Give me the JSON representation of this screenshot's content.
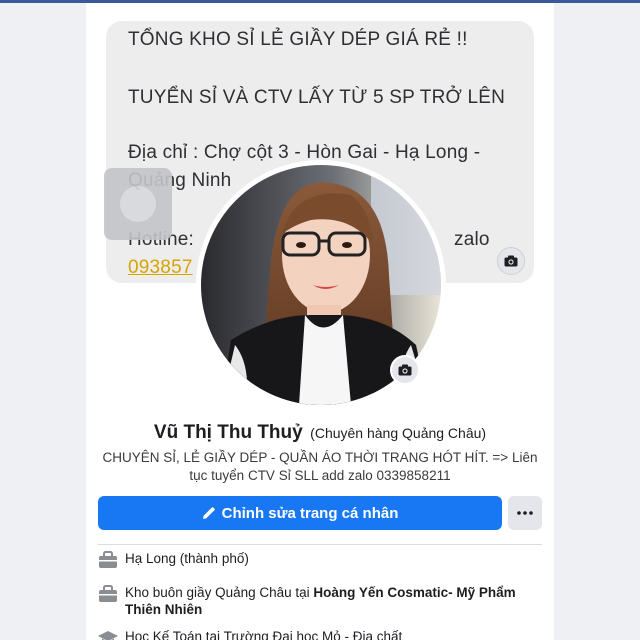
{
  "cover": {
    "lines": [
      "TỔNG KHO SỈ LẺ GIẦY DÉP GIÁ RẺ !!",
      "TUYỂN SỈ VÀ CTV LẤY TỪ 5 SP TRỞ LÊN",
      "Địa chỉ : Chợ cột 3 - Hòn Gai - Hạ Long -",
      "Quảng Ninh",
      "Hotline:",
      "zalo"
    ],
    "phone_partial": "093857",
    "camera_icon": "camera-icon"
  },
  "profile": {
    "name": "Vũ Thị Thu Thuỷ",
    "alternate_name": "(Chuyên hàng Quảng Châu)",
    "bio": "CHUYÊN SỈ, LẺ GIẦY DÉP - QUẦN ÁO THỜI TRANG HÓT HÍT. => Liên tục tuyển CTV Sỉ SLL add zalo 0339858211",
    "edit_button_label": "Chỉnh sửa trang cá nhân",
    "more_icon": "ellipsis-icon"
  },
  "intro": [
    {
      "icon": "briefcase-icon",
      "prefix": "Hạ Long (thành phố)",
      "bold": ""
    },
    {
      "icon": "briefcase-icon",
      "prefix": "Kho buôn giầy Quảng Châu tại ",
      "bold": "Hoàng Yến Cosmatic- Mỹ Phẩm Thiên Nhiên"
    },
    {
      "icon": "graduation-cap-icon",
      "prefix": "Học Kế Toán tại Trường Đại học Mỏ - Địa chất",
      "bold": ""
    }
  ],
  "colors": {
    "primary": "#1877f2",
    "top_bar": "#3b5998",
    "cover_bg": "#ededee",
    "phone_link": "#d6a400"
  }
}
